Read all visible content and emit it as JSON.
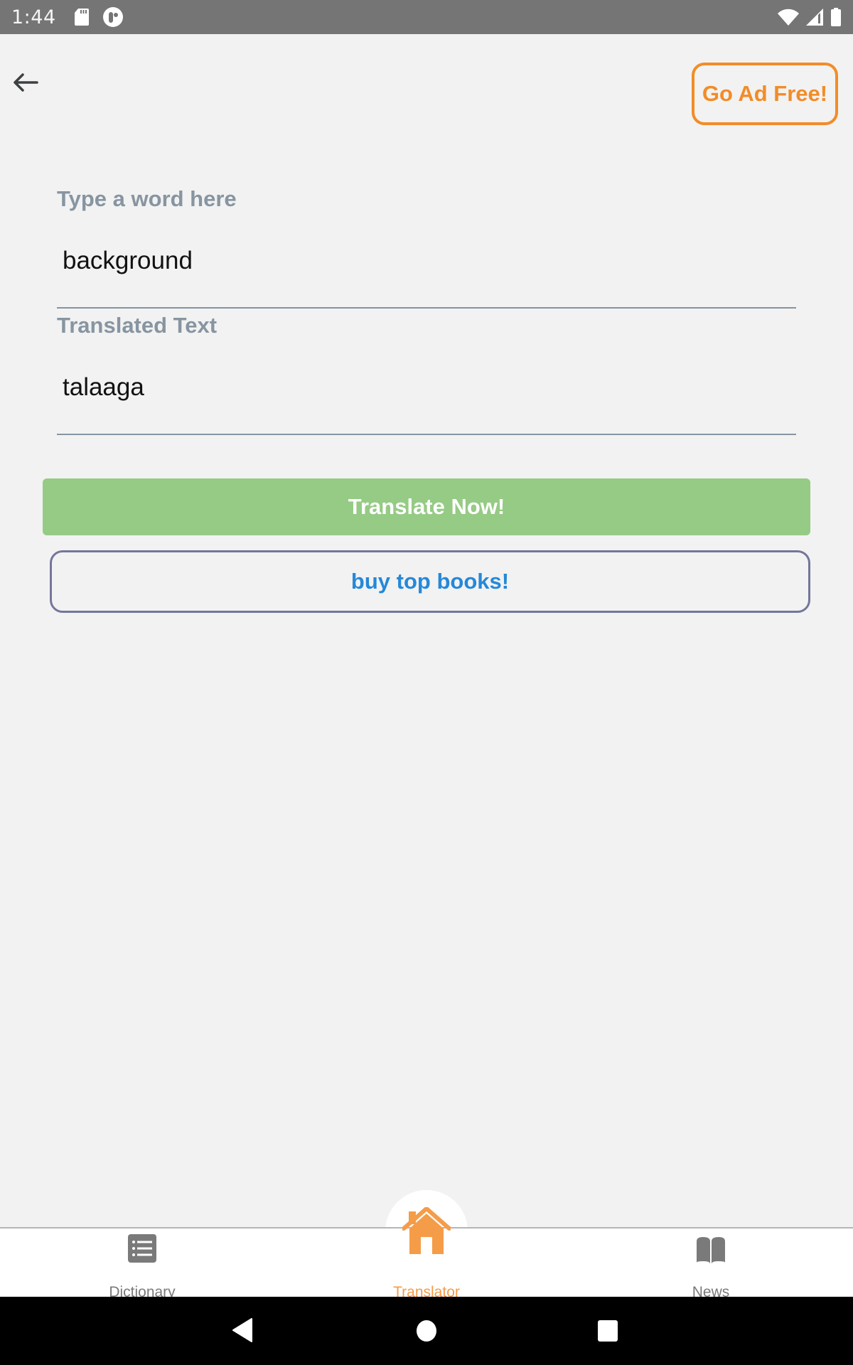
{
  "status_bar": {
    "time": "1:44",
    "left_icons": [
      "sd-card-icon",
      "app-notification-icon"
    ],
    "right_icons": [
      "wifi-icon",
      "signal-icon",
      "battery-icon"
    ]
  },
  "header": {
    "back_icon": "arrow-left-icon",
    "ad_free_label": "Go Ad Free!"
  },
  "form": {
    "input_label": "Type a word here",
    "input_value": "background",
    "output_label": "Translated Text",
    "output_value": "talaaga"
  },
  "actions": {
    "translate_label": "Translate Now!",
    "books_label": "buy top books!"
  },
  "bottom_nav": {
    "items": [
      {
        "label": "Dictionary",
        "icon": "list-icon",
        "active": false
      },
      {
        "label": "Translator",
        "icon": "home-icon",
        "active": true
      },
      {
        "label": "News",
        "icon": "book-open-icon",
        "active": false
      }
    ]
  },
  "system_nav": {
    "buttons": [
      "back-triangle-icon",
      "home-circle-icon",
      "recents-square-icon"
    ]
  },
  "colors": {
    "accent_orange": "#f28c28",
    "nav_active": "#f59c48",
    "translate_green": "#95cb84",
    "books_border": "#74769c",
    "books_text": "#2588d8",
    "label_gray": "#8795a1",
    "background": "#f2f2f2"
  }
}
